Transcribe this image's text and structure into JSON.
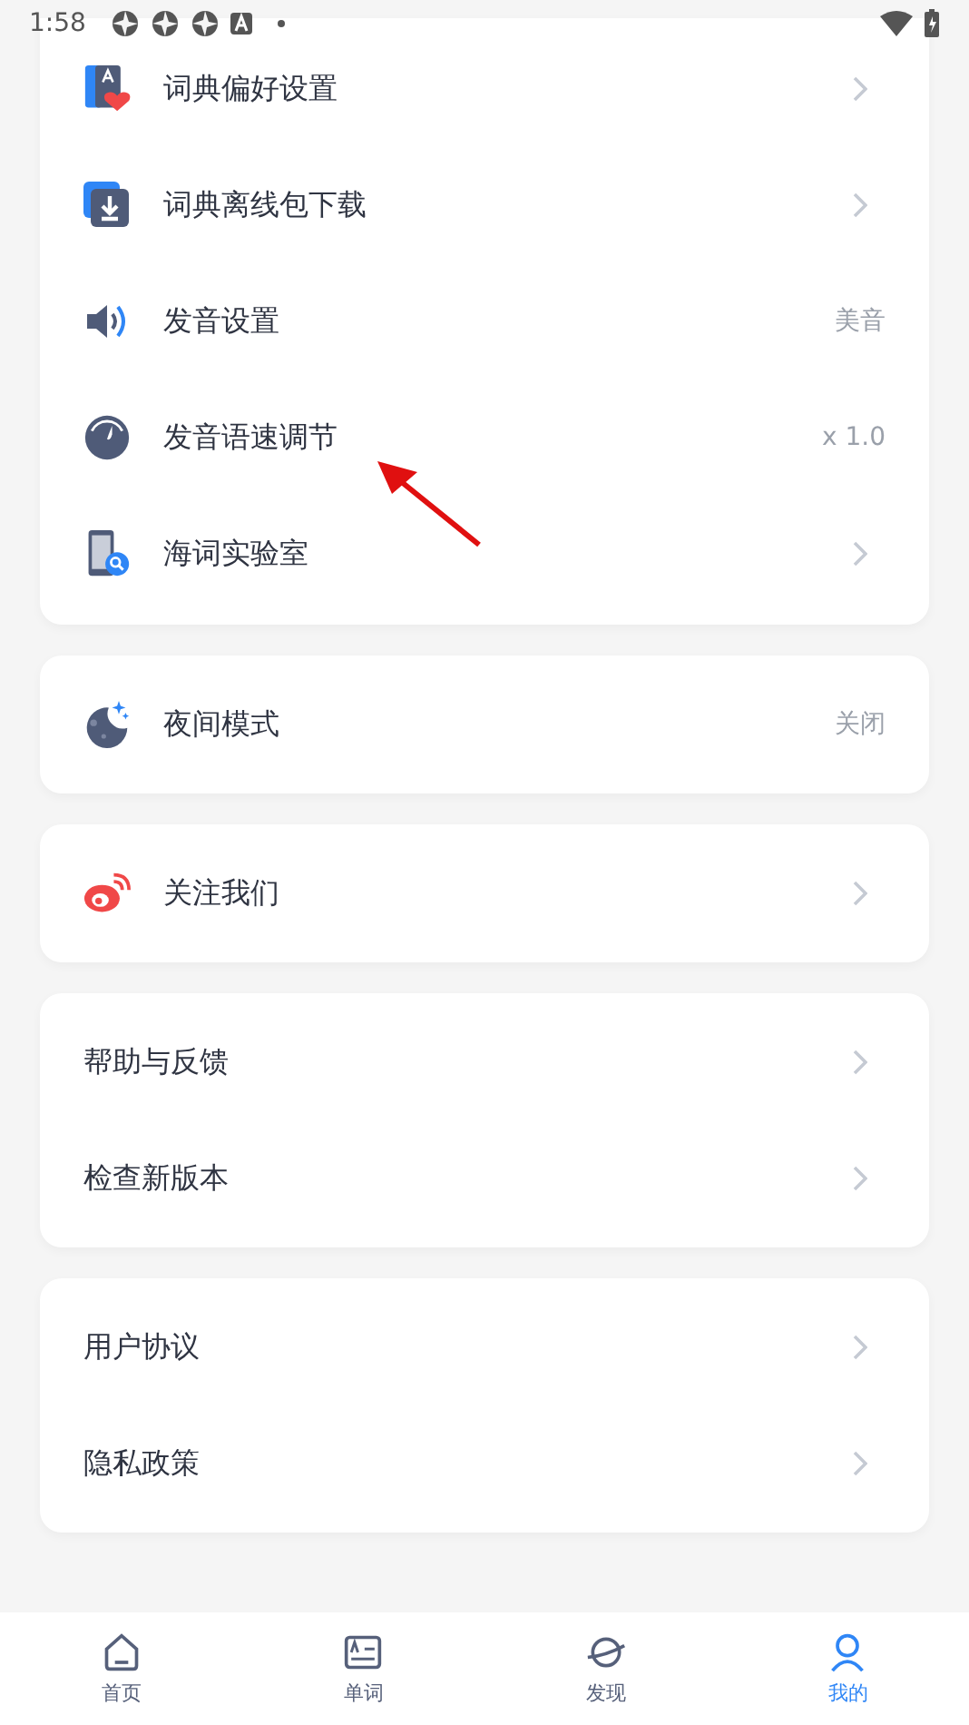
{
  "status_bar": {
    "time": "1:58"
  },
  "sections": [
    {
      "items": [
        {
          "label": "词典偏好设置",
          "kind": "chevron"
        },
        {
          "label": "词典离线包下载",
          "kind": "chevron"
        },
        {
          "label": "发音设置",
          "kind": "value",
          "value": "美音"
        },
        {
          "label": "发音语速调节",
          "kind": "value",
          "value": "x 1.0"
        },
        {
          "label": "海词实验室",
          "kind": "chevron"
        }
      ]
    },
    {
      "items": [
        {
          "label": "夜间模式",
          "kind": "value",
          "value": "关闭"
        }
      ]
    },
    {
      "items": [
        {
          "label": "关注我们",
          "kind": "chevron"
        }
      ]
    },
    {
      "items": [
        {
          "label": "帮助与反馈",
          "kind": "chevron"
        },
        {
          "label": "检查新版本",
          "kind": "chevron"
        }
      ]
    },
    {
      "items": [
        {
          "label": "用户协议",
          "kind": "chevron"
        },
        {
          "label": "隐私政策",
          "kind": "chevron"
        }
      ]
    }
  ],
  "bottom_nav": [
    {
      "label": "首页",
      "selected": false
    },
    {
      "label": "单词",
      "selected": false
    },
    {
      "label": "发现",
      "selected": false
    },
    {
      "label": "我的",
      "selected": true
    }
  ]
}
